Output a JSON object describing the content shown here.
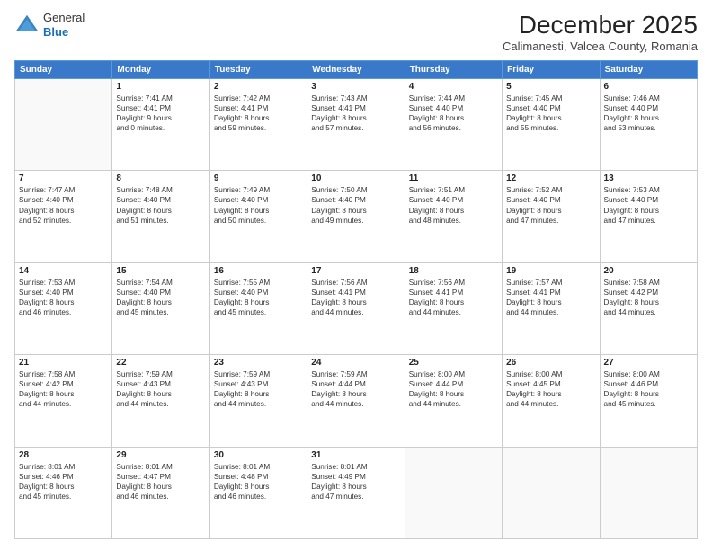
{
  "logo": {
    "general": "General",
    "blue": "Blue"
  },
  "title": "December 2025",
  "location": "Calimanesti, Valcea County, Romania",
  "days_of_week": [
    "Sunday",
    "Monday",
    "Tuesday",
    "Wednesday",
    "Thursday",
    "Friday",
    "Saturday"
  ],
  "weeks": [
    [
      {
        "day": "",
        "info": ""
      },
      {
        "day": "1",
        "info": "Sunrise: 7:41 AM\nSunset: 4:41 PM\nDaylight: 9 hours\nand 0 minutes."
      },
      {
        "day": "2",
        "info": "Sunrise: 7:42 AM\nSunset: 4:41 PM\nDaylight: 8 hours\nand 59 minutes."
      },
      {
        "day": "3",
        "info": "Sunrise: 7:43 AM\nSunset: 4:41 PM\nDaylight: 8 hours\nand 57 minutes."
      },
      {
        "day": "4",
        "info": "Sunrise: 7:44 AM\nSunset: 4:40 PM\nDaylight: 8 hours\nand 56 minutes."
      },
      {
        "day": "5",
        "info": "Sunrise: 7:45 AM\nSunset: 4:40 PM\nDaylight: 8 hours\nand 55 minutes."
      },
      {
        "day": "6",
        "info": "Sunrise: 7:46 AM\nSunset: 4:40 PM\nDaylight: 8 hours\nand 53 minutes."
      }
    ],
    [
      {
        "day": "7",
        "info": "Sunrise: 7:47 AM\nSunset: 4:40 PM\nDaylight: 8 hours\nand 52 minutes."
      },
      {
        "day": "8",
        "info": "Sunrise: 7:48 AM\nSunset: 4:40 PM\nDaylight: 8 hours\nand 51 minutes."
      },
      {
        "day": "9",
        "info": "Sunrise: 7:49 AM\nSunset: 4:40 PM\nDaylight: 8 hours\nand 50 minutes."
      },
      {
        "day": "10",
        "info": "Sunrise: 7:50 AM\nSunset: 4:40 PM\nDaylight: 8 hours\nand 49 minutes."
      },
      {
        "day": "11",
        "info": "Sunrise: 7:51 AM\nSunset: 4:40 PM\nDaylight: 8 hours\nand 48 minutes."
      },
      {
        "day": "12",
        "info": "Sunrise: 7:52 AM\nSunset: 4:40 PM\nDaylight: 8 hours\nand 47 minutes."
      },
      {
        "day": "13",
        "info": "Sunrise: 7:53 AM\nSunset: 4:40 PM\nDaylight: 8 hours\nand 47 minutes."
      }
    ],
    [
      {
        "day": "14",
        "info": "Sunrise: 7:53 AM\nSunset: 4:40 PM\nDaylight: 8 hours\nand 46 minutes."
      },
      {
        "day": "15",
        "info": "Sunrise: 7:54 AM\nSunset: 4:40 PM\nDaylight: 8 hours\nand 45 minutes."
      },
      {
        "day": "16",
        "info": "Sunrise: 7:55 AM\nSunset: 4:40 PM\nDaylight: 8 hours\nand 45 minutes."
      },
      {
        "day": "17",
        "info": "Sunrise: 7:56 AM\nSunset: 4:41 PM\nDaylight: 8 hours\nand 44 minutes."
      },
      {
        "day": "18",
        "info": "Sunrise: 7:56 AM\nSunset: 4:41 PM\nDaylight: 8 hours\nand 44 minutes."
      },
      {
        "day": "19",
        "info": "Sunrise: 7:57 AM\nSunset: 4:41 PM\nDaylight: 8 hours\nand 44 minutes."
      },
      {
        "day": "20",
        "info": "Sunrise: 7:58 AM\nSunset: 4:42 PM\nDaylight: 8 hours\nand 44 minutes."
      }
    ],
    [
      {
        "day": "21",
        "info": "Sunrise: 7:58 AM\nSunset: 4:42 PM\nDaylight: 8 hours\nand 44 minutes."
      },
      {
        "day": "22",
        "info": "Sunrise: 7:59 AM\nSunset: 4:43 PM\nDaylight: 8 hours\nand 44 minutes."
      },
      {
        "day": "23",
        "info": "Sunrise: 7:59 AM\nSunset: 4:43 PM\nDaylight: 8 hours\nand 44 minutes."
      },
      {
        "day": "24",
        "info": "Sunrise: 7:59 AM\nSunset: 4:44 PM\nDaylight: 8 hours\nand 44 minutes."
      },
      {
        "day": "25",
        "info": "Sunrise: 8:00 AM\nSunset: 4:44 PM\nDaylight: 8 hours\nand 44 minutes."
      },
      {
        "day": "26",
        "info": "Sunrise: 8:00 AM\nSunset: 4:45 PM\nDaylight: 8 hours\nand 44 minutes."
      },
      {
        "day": "27",
        "info": "Sunrise: 8:00 AM\nSunset: 4:46 PM\nDaylight: 8 hours\nand 45 minutes."
      }
    ],
    [
      {
        "day": "28",
        "info": "Sunrise: 8:01 AM\nSunset: 4:46 PM\nDaylight: 8 hours\nand 45 minutes."
      },
      {
        "day": "29",
        "info": "Sunrise: 8:01 AM\nSunset: 4:47 PM\nDaylight: 8 hours\nand 46 minutes."
      },
      {
        "day": "30",
        "info": "Sunrise: 8:01 AM\nSunset: 4:48 PM\nDaylight: 8 hours\nand 46 minutes."
      },
      {
        "day": "31",
        "info": "Sunrise: 8:01 AM\nSunset: 4:49 PM\nDaylight: 8 hours\nand 47 minutes."
      },
      {
        "day": "",
        "info": ""
      },
      {
        "day": "",
        "info": ""
      },
      {
        "day": "",
        "info": ""
      }
    ]
  ]
}
